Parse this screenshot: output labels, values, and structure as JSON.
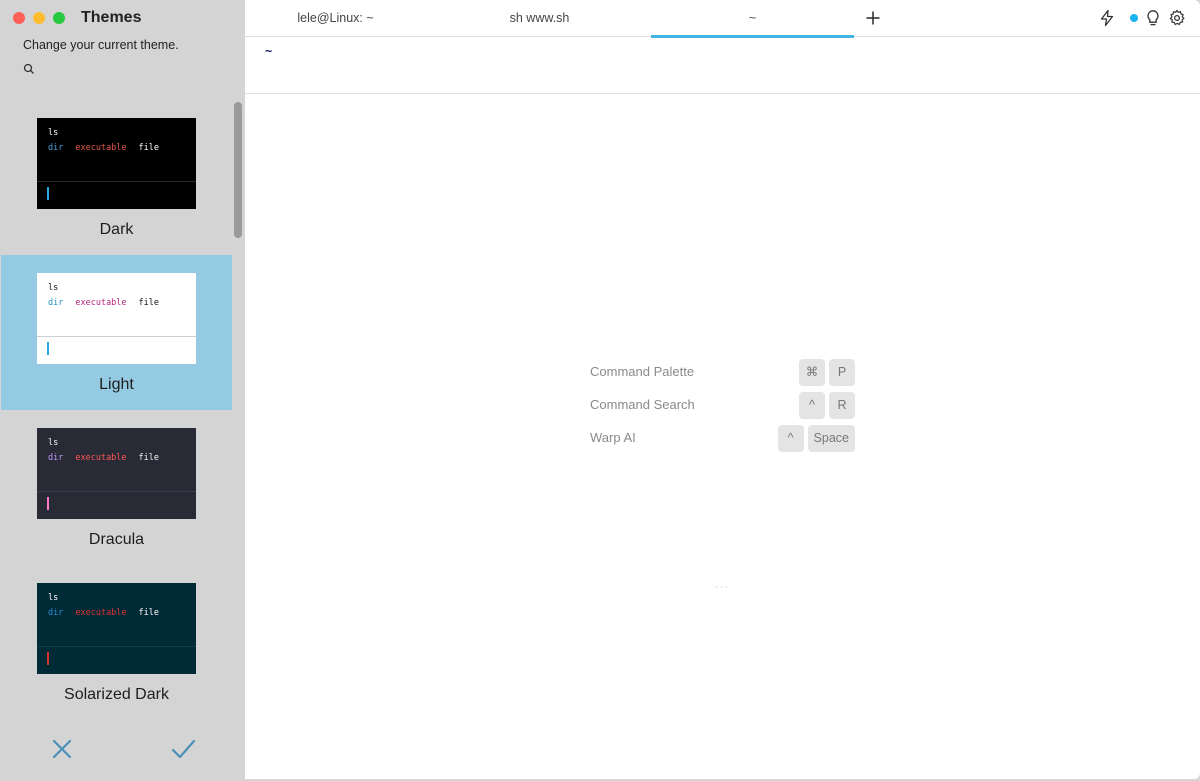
{
  "sidebar": {
    "title": "Themes",
    "subtitle": "Change your current theme.",
    "themes": [
      {
        "name": "Dark",
        "line1": "ls",
        "dir": "dir",
        "exec": "executable",
        "file": "file",
        "bg": "#000000",
        "fg": "#ffffff",
        "dirColor": "#4a9fd8",
        "execColor": "#e55a4d",
        "fileColor": "#ffffff",
        "cursorColor": "#2aa8e8",
        "dividerColor": "#2a2a2a"
      },
      {
        "name": "Light",
        "line1": "ls",
        "dir": "dir",
        "exec": "executable",
        "file": "file",
        "bg": "#ffffff",
        "fg": "#111111",
        "dirColor": "#2a8fc9",
        "execColor": "#b8267e",
        "fileColor": "#111111",
        "cursorColor": "#2aa8e8",
        "dividerColor": "#cfcfcf"
      },
      {
        "name": "Dracula",
        "line1": "ls",
        "dir": "dir",
        "exec": "executable",
        "file": "file",
        "bg": "#282a36",
        "fg": "#f8f8f2",
        "dirColor": "#bd93f9",
        "execColor": "#ff5555",
        "fileColor": "#f8f8f2",
        "cursorColor": "#ff79c6",
        "dividerColor": "#3c3e4c"
      },
      {
        "name": "Solarized Dark",
        "line1": "ls",
        "dir": "dir",
        "exec": "executable",
        "file": "file",
        "bg": "#002b36",
        "fg": "#ffffff",
        "dirColor": "#268bd2",
        "execColor": "#dc322f",
        "fileColor": "#ffffff",
        "cursorColor": "#dc322f",
        "dividerColor": "#0f3d48"
      }
    ],
    "selected_index": 1,
    "cancel_icon": "close-icon",
    "confirm_icon": "check-icon",
    "accent": "#4a90b8"
  },
  "tabs": [
    {
      "label": "lele@Linux: ~",
      "active": false
    },
    {
      "label": "sh www.sh",
      "active": false
    },
    {
      "label": "~",
      "active": true
    }
  ],
  "toolbar_icons": [
    "lightning-icon",
    "status-dot",
    "lightbulb-icon",
    "gear-icon"
  ],
  "prompt": {
    "text": "~"
  },
  "shortcuts": [
    {
      "label": "Command Palette",
      "keys": [
        "⌘",
        "P"
      ]
    },
    {
      "label": "Command Search",
      "keys": [
        "^",
        "R"
      ]
    },
    {
      "label": "Warp AI",
      "keys": [
        "^",
        "Space"
      ]
    }
  ],
  "ellipsis": "···"
}
